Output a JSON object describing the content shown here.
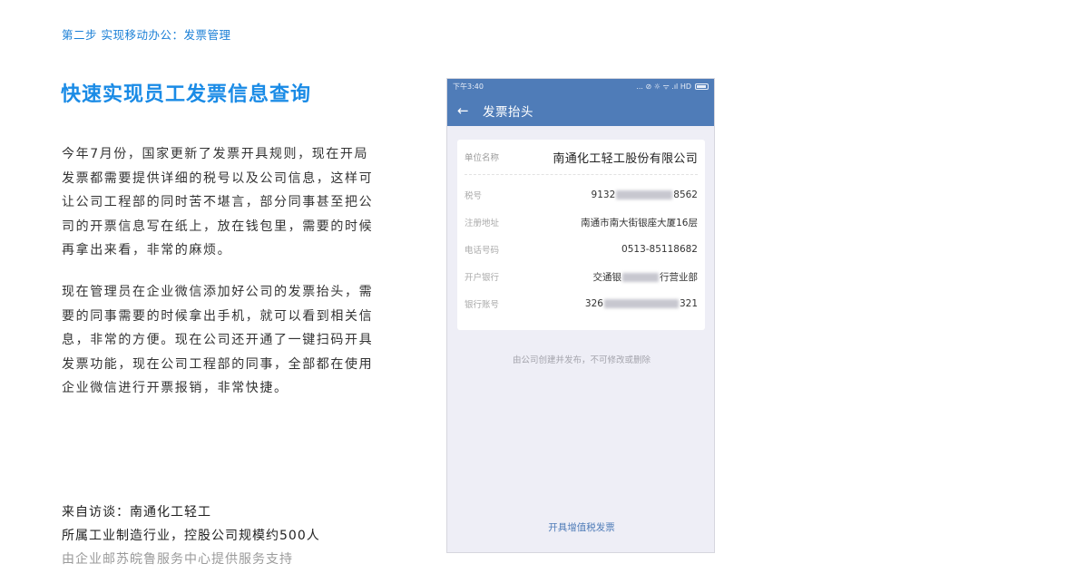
{
  "step_label": "第二步 实现移动办公：发票管理",
  "headline": "快速实现员工发票信息查询",
  "paragraph1": "今年7月份，国家更新了发票开具规则，现在开局发票都需要提供详细的税号以及公司信息，这样可让公司工程部的同时苦不堪言，部分同事甚至把公司的开票信息写在纸上，放在钱包里，需要的时候再拿出来看，非常的麻烦。",
  "paragraph2": "现在管理员在企业微信添加好公司的发票抬头，需要的同事需要的时候拿出手机，就可以看到相关信息，非常的方便。现在公司还开通了一键扫码开具发票功能，现在公司工程部的同事，全部都在使用企业微信进行开票报销，非常快捷。",
  "source": {
    "line1": "来自访谈：南通化工轻工",
    "line2": "所属工业制造行业，控股公司规模约500人",
    "line3": "由企业邮苏皖鲁服务中心提供服务支持"
  },
  "phone": {
    "status_time": "下午3:40",
    "status_icons": "... ⊘ ☼ ᯤ .ıl HD",
    "title": "发票抬头",
    "company_label": "单位名称",
    "company_name": "南通化工轻工股份有限公司",
    "fields": [
      {
        "label": "税号",
        "value_start": "9132",
        "value_end": "8562"
      },
      {
        "label": "注册地址",
        "value": "南通市南大街银座大厦16层"
      },
      {
        "label": "电话号码",
        "value": "0513-85118682"
      },
      {
        "label": "开户银行",
        "value_start": "交通银",
        "value_end": "行营业部"
      },
      {
        "label": "银行账号",
        "value_start": "326",
        "value_end": "321"
      }
    ],
    "note": "由公司创建并发布，不可修改或删除",
    "bottom_link": "开具增值税发票"
  }
}
